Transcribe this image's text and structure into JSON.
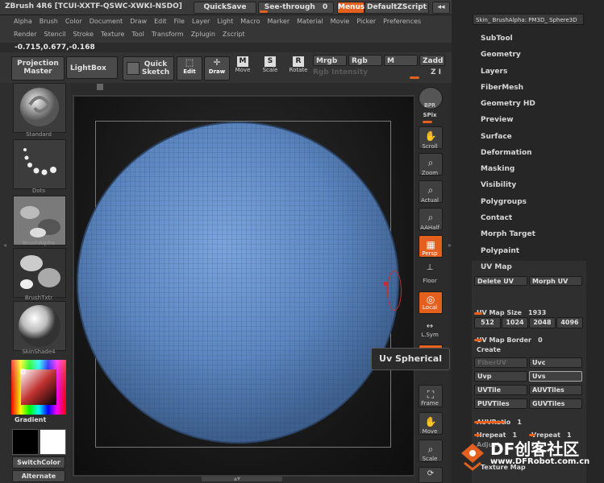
{
  "app": {
    "title": "ZBrush 4R6 [TCUI-XXTF-QSWC-XWKI-NSDO]",
    "quicksave": "QuickSave",
    "see_through": "See-through",
    "see_through_value": "0",
    "menus": "Menus",
    "default_zscript": "DefaultZScript"
  },
  "menubar": {
    "row1": [
      "Alpha",
      "Brush",
      "Color",
      "Document",
      "Draw",
      "Edit",
      "File",
      "Layer",
      "Light",
      "Macro",
      "Marker",
      "Material",
      "Movie",
      "Picker",
      "Preferences"
    ],
    "row2": [
      "Render",
      "Stencil",
      "Stroke",
      "Texture",
      "Tool",
      "Transform",
      "Zplugin",
      "Zscript"
    ]
  },
  "coords": "-0.715,0.677,-0.168",
  "shelf": {
    "projection_master": "Projection Master",
    "lightbox": "LightBox",
    "quick_sketch": "Quick Sketch",
    "edit": "Edit",
    "draw": "Draw",
    "move": "Move",
    "scale": "Scale",
    "rotate": "Rotate",
    "mrgb": "Mrgb",
    "rgb": "Rgb",
    "m": "M",
    "zadd": "Zadd",
    "zsub": "Z I",
    "rgb_intensity": "Rgb Intensity"
  },
  "left": {
    "standard": "Standard",
    "dots": "Dots",
    "brush_alpha": "BrushAlpha",
    "brush_txtr": "BrushTxtr",
    "skin_shade": "SkinShade4",
    "gradient": "Gradient",
    "switch_color": "SwitchColor",
    "alternate": "Alternate"
  },
  "right_shelf": {
    "bpr": "BPR",
    "spix": "SPix",
    "scroll": "Scroll",
    "zoom": "Zoom",
    "actual": "Actual",
    "aahalf": "AAHalf",
    "persp": "Persp",
    "floor": "Floor",
    "local": "Local",
    "lsym": "L.Sym",
    "xyz": "Qxyz",
    "frame": "Frame",
    "move": "Move",
    "scale": "Scale"
  },
  "tooltip": "Uv Spherical",
  "side": {
    "subtool_header": "Skin_ BrushAlpha: PM3D_ Sphere3D",
    "items": [
      "SubTool",
      "Geometry",
      "Layers",
      "FiberMesh",
      "Geometry HD",
      "Preview",
      "Surface",
      "Deformation",
      "Masking",
      "Visibility",
      "Polygroups",
      "Contact",
      "Morph Target",
      "Polypaint"
    ],
    "uv_map": {
      "title": "UV Map",
      "delete_uv": "Delete UV",
      "morph_uv": "Morph UV",
      "uv_map_size_label": "UV Map Size",
      "uv_map_size": "1933",
      "sizes": [
        "512",
        "1024",
        "2048",
        "4096"
      ],
      "uv_map_border_label": "UV Map Border",
      "uv_map_border": "0",
      "create": "Create",
      "buttons": [
        {
          "label": "FiberUV"
        },
        {
          "label": "Uvc"
        },
        {
          "label": "Uvp"
        },
        {
          "label": "Uvs"
        },
        {
          "label": "UVTile"
        },
        {
          "label": "AUVTiles"
        },
        {
          "label": "PUVTiles"
        },
        {
          "label": "GUVTiles"
        }
      ],
      "auv_ratio_label": "AUVRatio",
      "auv_ratio": "1",
      "hrepeat_label": "Hrepeat",
      "hrepeat": "1",
      "vrepeat_label": "Vrepeat",
      "vrepeat": "1",
      "adjust": "Adjust",
      "texture_map": "Texture Map"
    }
  },
  "watermark": {
    "brand": "DF创客社区",
    "url": "www.DFRobot.com.cn"
  },
  "colors": {
    "accent": "#e4601e",
    "sphere": "#5b86c0"
  }
}
